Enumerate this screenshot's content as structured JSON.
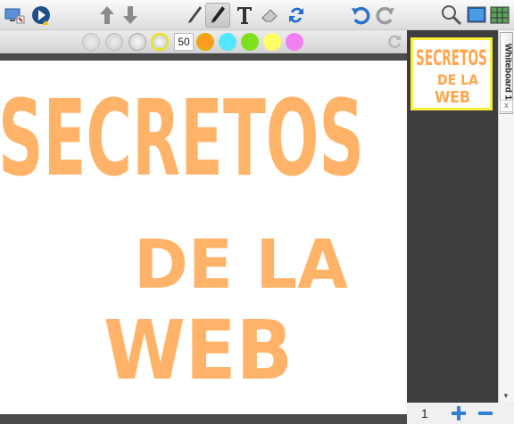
{
  "toolbar": {
    "items": [
      {
        "name": "display-settings-icon",
        "label": "Display settings"
      },
      {
        "name": "play-icon",
        "label": "Play"
      },
      {
        "name": "arrow-up-icon",
        "label": "Previous page"
      },
      {
        "name": "arrow-down-icon",
        "label": "Next page"
      },
      {
        "name": "pen-icon",
        "label": "Pen"
      },
      {
        "name": "marker-icon",
        "label": "Marker",
        "active": true
      },
      {
        "name": "text-icon",
        "label": "Text"
      },
      {
        "name": "eraser-icon",
        "label": "Eraser"
      },
      {
        "name": "swap-icon",
        "label": "Swap"
      },
      {
        "name": "undo-icon",
        "label": "Undo"
      },
      {
        "name": "redo-icon",
        "label": "Redo"
      },
      {
        "name": "zoom-icon",
        "label": "Zoom"
      },
      {
        "name": "background-icon",
        "label": "Background"
      },
      {
        "name": "grid-icon",
        "label": "Grid"
      }
    ]
  },
  "properties": {
    "size_value": "50",
    "colors": [
      "#ff9a1e",
      "#52e6ff",
      "#7ee01c",
      "#ffff66",
      "#f27ff2"
    ],
    "selected_color": "#ff9a1e"
  },
  "canvas": {
    "ink_color": "#ffa64d",
    "lines": [
      "SECRETOS",
      "DE LA",
      "WEB"
    ]
  },
  "side_panel": {
    "tab_label": "Whiteboard 1",
    "close_label": "x",
    "thumbnail_lines": [
      "SECRETOS",
      "DE LA",
      "WEB"
    ]
  },
  "footer": {
    "page_number": "1"
  }
}
